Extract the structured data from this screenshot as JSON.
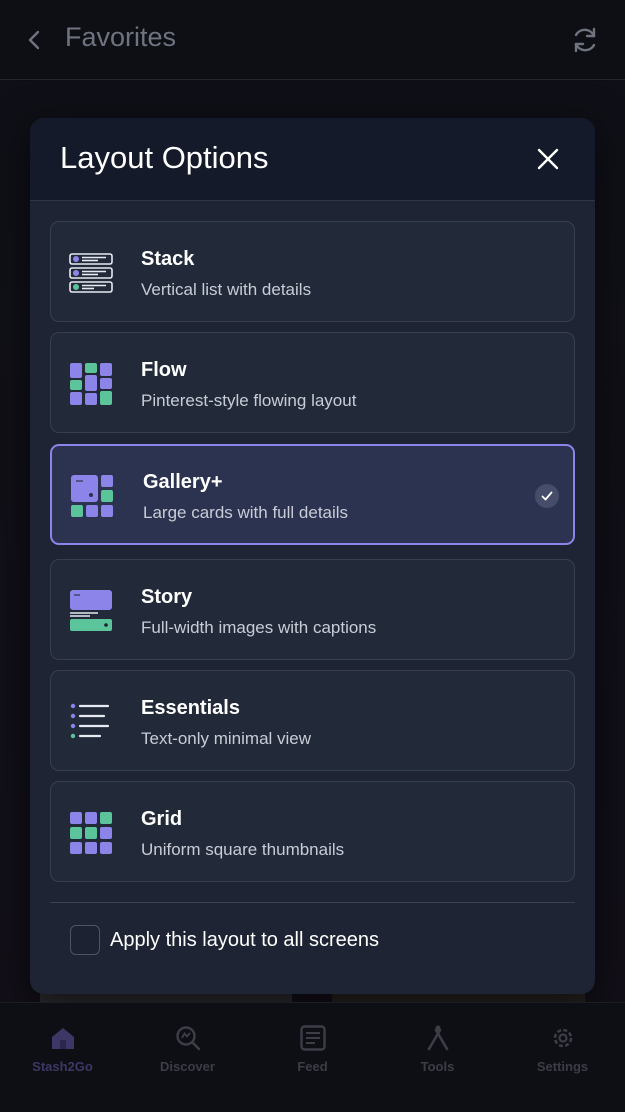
{
  "header": {
    "title": "Favorites"
  },
  "modal": {
    "title": "Layout Options",
    "options": [
      {
        "title": "Stack",
        "description": "Vertical list with details",
        "icon": "stack-layout-icon",
        "selected": false
      },
      {
        "title": "Flow",
        "description": "Pinterest-style flowing layout",
        "icon": "flow-layout-icon",
        "selected": false
      },
      {
        "title": "Gallery+",
        "description": "Large cards with full details",
        "icon": "gallery-layout-icon",
        "selected": true
      },
      {
        "title": "Story",
        "description": "Full-width images with captions",
        "icon": "story-layout-icon",
        "selected": false
      },
      {
        "title": "Essentials",
        "description": "Text-only minimal view",
        "icon": "essentials-layout-icon",
        "selected": false
      },
      {
        "title": "Grid",
        "description": "Uniform square thumbnails",
        "icon": "grid-layout-icon",
        "selected": false
      }
    ],
    "apply_all_label": "Apply this layout to all screens",
    "apply_all_checked": false
  },
  "tabs": [
    {
      "label": "Stash2Go",
      "icon": "home-icon",
      "active": true
    },
    {
      "label": "Discover",
      "icon": "discover-icon",
      "active": false
    },
    {
      "label": "Feed",
      "icon": "feed-icon",
      "active": false
    },
    {
      "label": "Tools",
      "icon": "tools-icon",
      "active": false
    },
    {
      "label": "Settings",
      "icon": "gear-icon",
      "active": false
    }
  ],
  "colors": {
    "accent_purple": "#8c84e8",
    "accent_green": "#5cc49a",
    "modal_bg": "#1e2433",
    "selected_bg": "#2b3350"
  }
}
